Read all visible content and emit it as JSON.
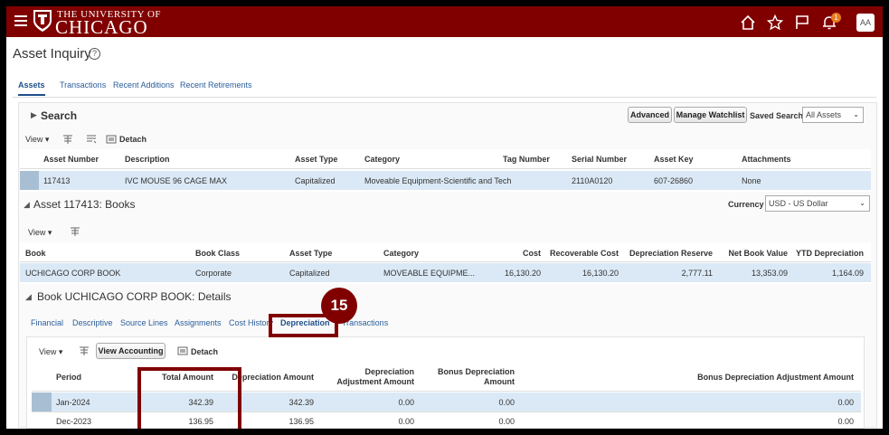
{
  "header": {
    "logo_top": "THE UNIVERSITY OF",
    "logo_main": "CHICAGO",
    "notification_count": "1",
    "avatar": "AA"
  },
  "page": {
    "title": "Asset Inquiry",
    "help": "?"
  },
  "tabs": [
    "Assets",
    "Transactions",
    "Recent Additions",
    "Recent Retirements"
  ],
  "search": {
    "title": "Search",
    "advanced": "Advanced",
    "manage_watchlist": "Manage Watchlist",
    "saved_search_label": "Saved Search",
    "saved_search_value": "All Assets",
    "view": "View",
    "detach": "Detach",
    "columns": [
      "Asset Number",
      "Description",
      "Asset Type",
      "Category",
      "Tag Number",
      "Serial Number",
      "Asset Key",
      "Attachments"
    ],
    "row": [
      "117413",
      "IVC MOUSE 96 CAGE MAX",
      "Capitalized",
      "Moveable Equipment-Scientific and Tech",
      "",
      "2110A0120",
      "607-26860",
      "None"
    ]
  },
  "books": {
    "title": "Asset 117413: Books",
    "currency_label": "Currency",
    "currency_value": "USD - US Dollar",
    "view": "View",
    "columns": [
      "Book",
      "Book Class",
      "Asset Type",
      "Category",
      "Cost",
      "Recoverable Cost",
      "Depreciation Reserve",
      "Net Book Value",
      "YTD Depreciation"
    ],
    "row": [
      "UCHICAGO CORP BOOK",
      "Corporate",
      "Capitalized",
      "MOVEABLE EQUIPME...",
      "16,130.20",
      "16,130.20",
      "2,777.11",
      "13,353.09",
      "1,164.09"
    ]
  },
  "details": {
    "title": "Book UCHICAGO CORP BOOK: Details",
    "tabs": [
      "Financial",
      "Descriptive",
      "Source Lines",
      "Assignments",
      "Cost History",
      "Depreciation",
      "Transactions"
    ],
    "view": "View",
    "view_accounting": "View Accounting",
    "detach": "Detach",
    "columns": {
      "period": "Period",
      "total_amount": "Total Amount",
      "depreciation_amount": "Depreciation Amount",
      "dep_adj_1": "Depreciation",
      "dep_adj_2": "Adjustment Amount",
      "bonus_dep_1": "Bonus Depreciation",
      "bonus_dep_2": "Amount",
      "bonus_adj": "Bonus Depreciation Adjustment Amount"
    },
    "rows": [
      [
        "Jan-2024",
        "342.39",
        "342.39",
        "0.00",
        "0.00",
        "0.00"
      ],
      [
        "Dec-2023",
        "136.95",
        "136.95",
        "0.00",
        "0.00",
        "0.00"
      ]
    ]
  },
  "callout": "15",
  "colors": {
    "brand": "#800000",
    "link": "#2a5d9a",
    "selected_row": "#dbe9f6"
  }
}
